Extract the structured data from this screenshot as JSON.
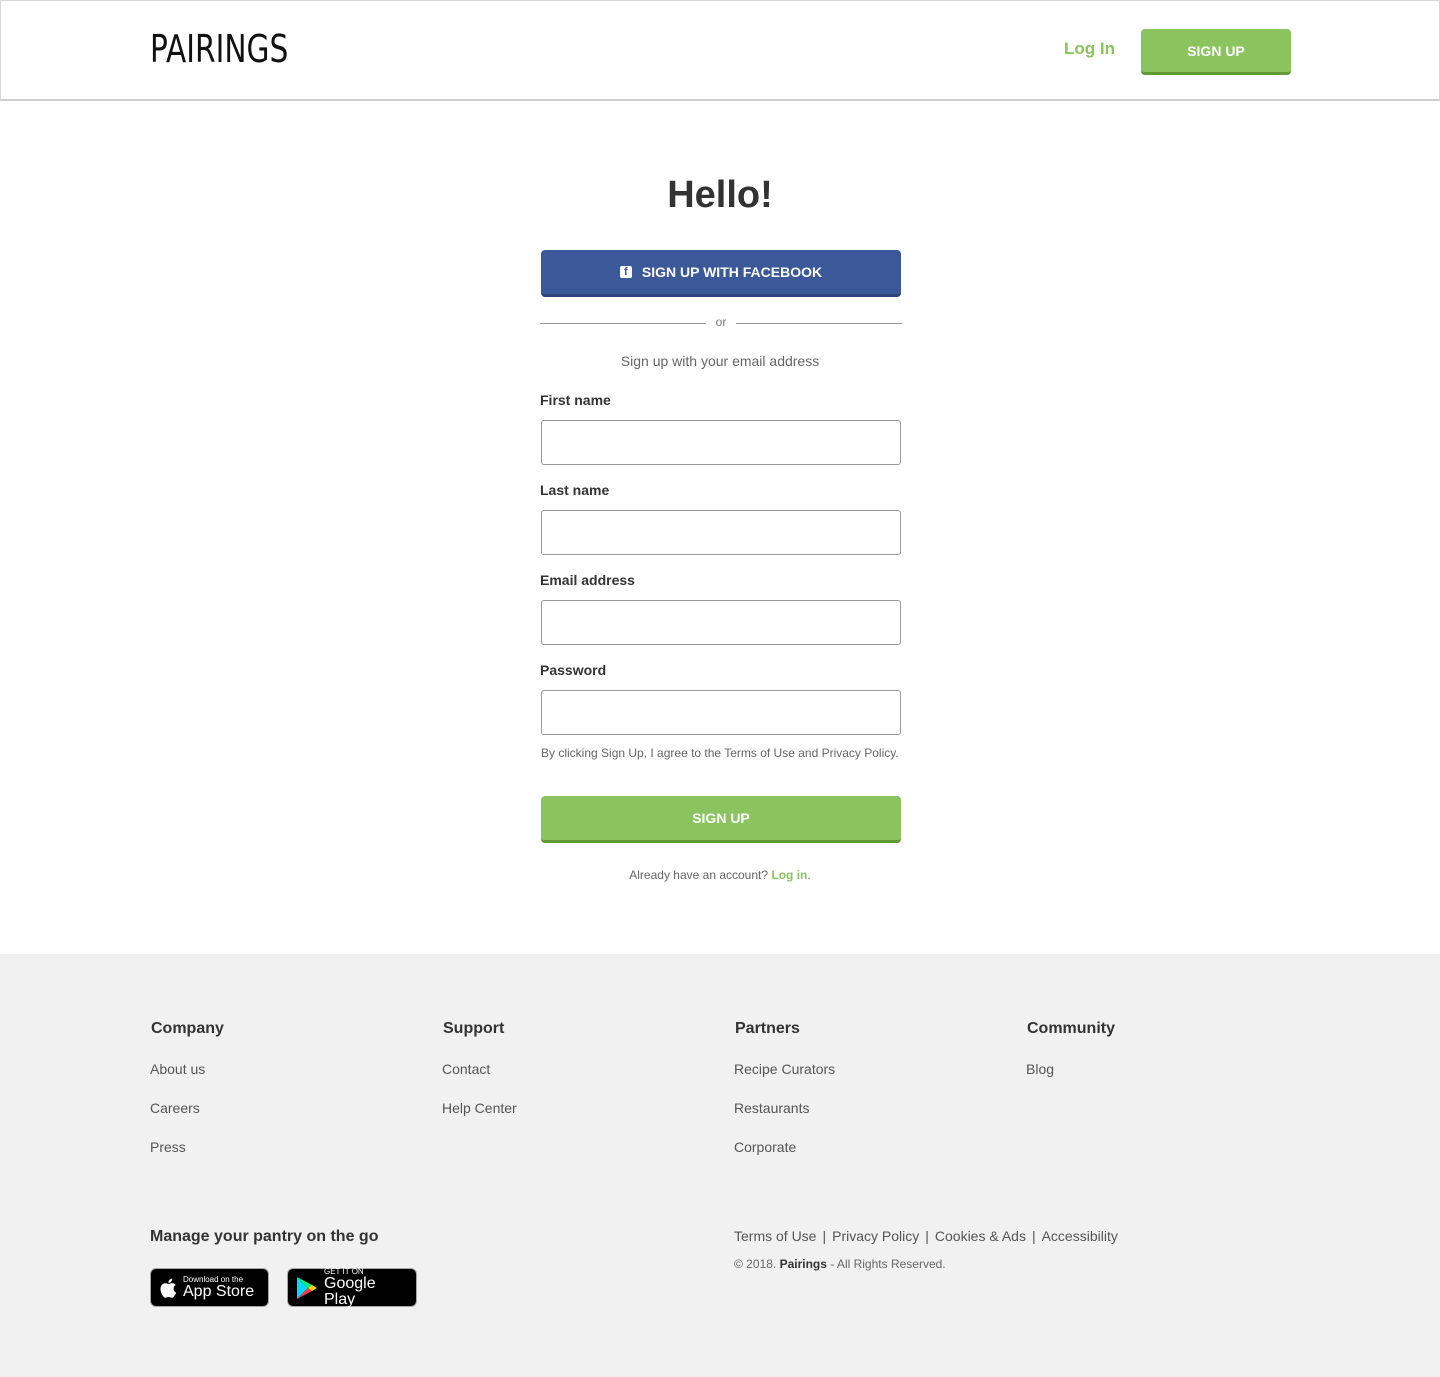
{
  "header": {
    "logo": "PAIRINGS",
    "login_label": "Log In",
    "signup_label": "SIGN UP"
  },
  "main": {
    "title": "Hello!",
    "facebook_label": "SIGN UP WITH FACEBOOK",
    "divider_text": "or",
    "email_hint": "Sign up with your email address",
    "fields": [
      {
        "label": "First name",
        "value": ""
      },
      {
        "label": "Last name",
        "value": ""
      },
      {
        "label": "Email address",
        "value": ""
      },
      {
        "label": "Password",
        "value": ""
      }
    ],
    "terms": "By clicking Sign Up, I agree to the Terms of Use and Privacy Policy.",
    "signup_label": "SIGN UP",
    "already_text": "Already have an account?",
    "login_link": "Log in",
    "already_suffix": "."
  },
  "footer": {
    "columns": [
      {
        "heading": "Company",
        "links": [
          "About us",
          "Careers",
          "Press"
        ]
      },
      {
        "heading": "Support",
        "links": [
          "Contact",
          "Help Center"
        ]
      },
      {
        "heading": "Partners",
        "links": [
          "Recipe Curators",
          "Restaurants",
          "Corporate"
        ]
      },
      {
        "heading": "Community",
        "links": [
          "Blog"
        ]
      }
    ],
    "pantry": "Manage your pantry on the go",
    "app_store": {
      "small": "Download on the",
      "big": "App Store",
      "icon": "apple-icon"
    },
    "google_play": {
      "small": "GET IT ON",
      "big": "Google Play",
      "icon": "google-play-icon"
    },
    "legal_links": [
      "Terms of Use",
      "Privacy Policy",
      "Cookies & Ads",
      "Accessibility"
    ],
    "legal_separator": "|",
    "copyright_prefix": "© 2018.",
    "copyright_brand": "Pairings",
    "copyright_suffix": "- All Rights Reserved."
  },
  "colors": {
    "accent_green": "#8bc35f",
    "facebook_blue": "#3b5998",
    "footer_bg": "#f1f1f1"
  }
}
